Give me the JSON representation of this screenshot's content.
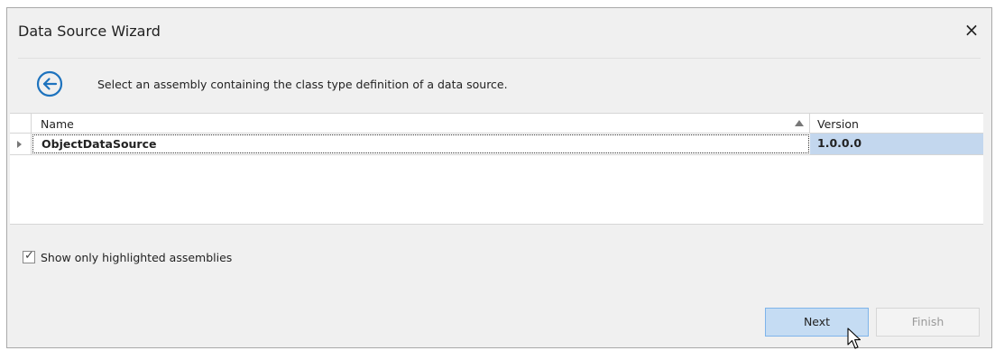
{
  "window": {
    "title": "Data Source Wizard",
    "close_glyph": "×"
  },
  "header": {
    "back_icon": "circled-left-arrow-icon",
    "instruction": "Select an assembly containing the class type definition of a data source."
  },
  "grid": {
    "columns": [
      {
        "label": "Name",
        "sort": "ascending"
      },
      {
        "label": "Version"
      }
    ],
    "rows": [
      {
        "name": "ObjectDataSource",
        "version": "1.0.0.0",
        "selected": true
      }
    ]
  },
  "options": {
    "show_highlighted_label": "Show only highlighted assemblies",
    "show_highlighted_checked": true,
    "check_glyph": "✓"
  },
  "buttons": {
    "next_label": "Next",
    "finish_label": "Finish",
    "finish_enabled": false
  },
  "colors": {
    "accent": "#1e73be",
    "selection": "#c3d7ee",
    "next_button_bg": "#c5dcf3"
  }
}
